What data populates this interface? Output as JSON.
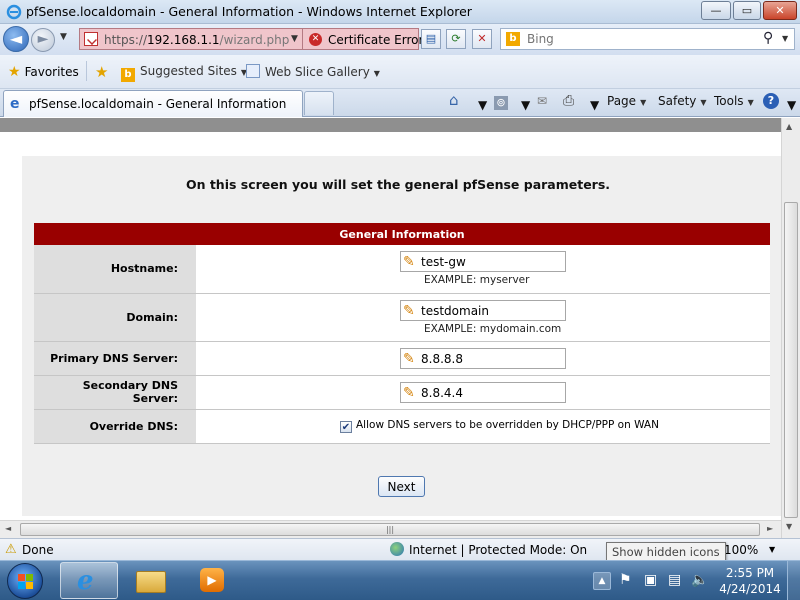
{
  "window": {
    "title": "pfSense.localdomain - General Information - Windows Internet Explorer",
    "min_glyph": "—",
    "max_glyph": "▭",
    "close_glyph": "✕"
  },
  "navigation": {
    "back_glyph": "◄",
    "forward_glyph": "►",
    "dropdown_glyph": "▼",
    "url_scheme": "https://",
    "url_host": "192.168.1.1",
    "url_path": "/wizard.php",
    "cert_error_label": "Certificate Error",
    "search_placeholder": "Bing",
    "search_glyph": "⚲"
  },
  "favorites_bar": {
    "favorites_label": "Favorites",
    "suggested_sites_label": "Suggested Sites",
    "web_slice_label": "Web Slice Gallery"
  },
  "tabs": {
    "active_label": "pfSense.localdomain - General Information"
  },
  "command_bar": {
    "page_label": "Page",
    "safety_label": "Safety",
    "tools_label": "Tools",
    "help_glyph": "?"
  },
  "wizard": {
    "intro": "On this screen you will set the general pfSense parameters.",
    "section_title": "General Information",
    "fields": [
      {
        "label": "Hostname:",
        "value": "test-gw",
        "example": "EXAMPLE: myserver"
      },
      {
        "label": "Domain:",
        "value": "testdomain",
        "example": "EXAMPLE: mydomain.com"
      },
      {
        "label": "Primary DNS Server:",
        "value": "8.8.8.8"
      },
      {
        "label": "Secondary DNS Server:",
        "value": "8.8.4.4"
      }
    ],
    "override_dns": {
      "label": "Override DNS:",
      "checked": true,
      "check_glyph": "✔",
      "description": "Allow DNS servers to be overridden by DHCP/PPP on WAN"
    },
    "next_label": "Next"
  },
  "statusbar": {
    "status": "Done",
    "zone": "Internet | Protected Mode: On",
    "zoom": "100%",
    "tooltip": "Show hidden icons"
  },
  "taskbar": {
    "time": "2:55 PM",
    "date": "4/24/2014",
    "ie_glyph": "e"
  },
  "colors": {
    "section_header": "#990000",
    "address_error_bg": "#f0c5cb"
  }
}
